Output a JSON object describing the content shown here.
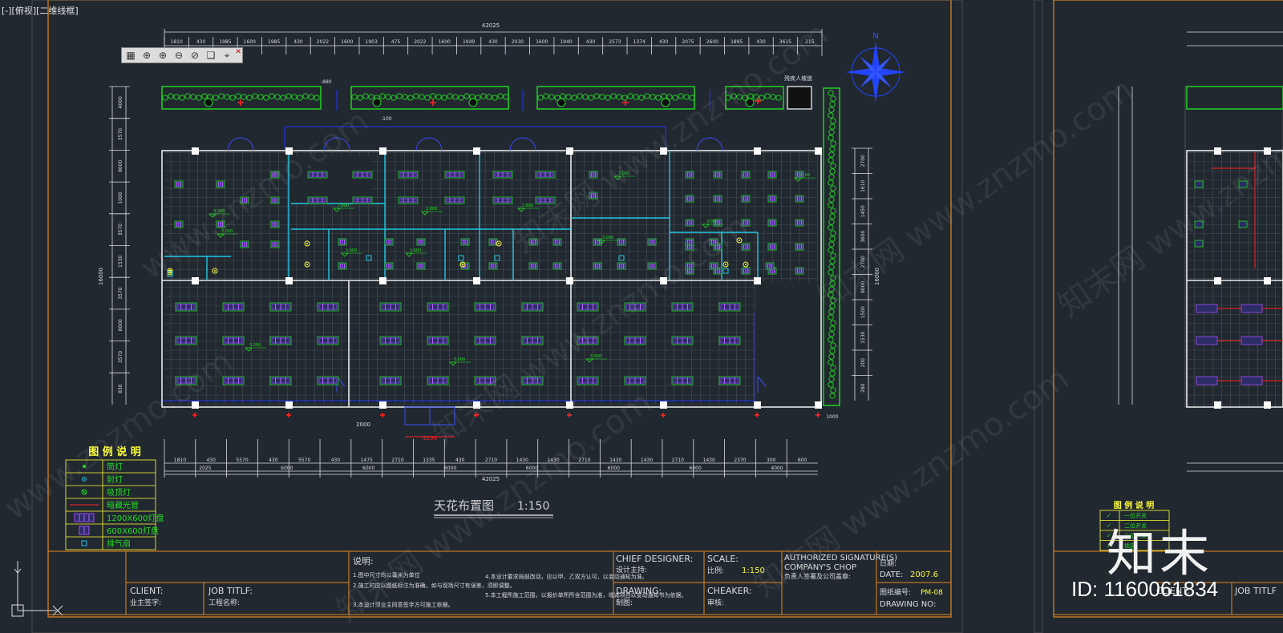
{
  "viewport_label": "[-][俯视][二维线框]",
  "toolbar": {
    "buttons": [
      "view-box-icon",
      "orbit-icon",
      "orbit-plus-icon",
      "orbit-minus-icon",
      "zoom-icon",
      "cube-icon",
      "crosshair-icon"
    ]
  },
  "top_dims": {
    "overall": "42025",
    "segments": [
      "1810",
      "430",
      "1985",
      "1600",
      "1985",
      "430",
      "2022",
      "1600",
      "1903",
      "475",
      "2022",
      "1600",
      "1949",
      "430",
      "2030",
      "1600",
      "1940",
      "430",
      "2573",
      "1374",
      "430",
      "2075",
      "2600",
      "1895",
      "430",
      "3615",
      "215"
    ]
  },
  "bottom_dims": {
    "overall": "42025",
    "row1": [
      "1810",
      "430",
      "5570",
      "430",
      "5570",
      "430",
      "1475",
      "2710",
      "1335",
      "430",
      "2710",
      "1430",
      "1430",
      "2710",
      "1430",
      "1430",
      "2710",
      "1430",
      "2370",
      "300",
      "600"
    ],
    "row2": [
      "2025",
      "6000",
      "6000",
      "6000",
      "6000",
      "6000",
      "6000",
      "4000"
    ]
  },
  "left_dims": {
    "overall": "16000",
    "parts": [
      "4000",
      "3570",
      "8000",
      "1000",
      "3570",
      "1530",
      "3570",
      "8000",
      "3570",
      "830"
    ]
  },
  "right_dims": {
    "overall": "16000",
    "parts": [
      "2700",
      "1610",
      "1450",
      "3600",
      "2700",
      "8000",
      "1500",
      "1530",
      "200",
      "280"
    ]
  },
  "annotations": {
    "ramp": "残疾人坡道",
    "level_top": "-880",
    "level_mid": "-100",
    "dim_door_left": "2000",
    "dim_door": "3290",
    "dim_right_bottom": "1000",
    "ceiling_tag": "3.000",
    "ceiling_tag2": "2.800",
    "ceiling_tag3": "3.100"
  },
  "compass": {
    "label": "N"
  },
  "drawing_title": "天花布置图",
  "drawing_scale": "1:150",
  "legend": {
    "title": "图 例 说 明",
    "items": [
      {
        "symbol": "downlight-icon",
        "label": "筒灯"
      },
      {
        "symbol": "spotlight-icon",
        "label": "射灯"
      },
      {
        "symbol": "ceiling-lamp-icon",
        "label": "吸顶灯"
      },
      {
        "symbol": "light-strip-icon",
        "label": "暗藏光管"
      },
      {
        "symbol": "grille-1200-icon",
        "label": "1200X600灯盘"
      },
      {
        "symbol": "grille-600-icon",
        "label": "600X600灯盘"
      },
      {
        "symbol": "fan-icon",
        "label": "排气扇"
      }
    ]
  },
  "title_block": {
    "client_label": "CLIENT:",
    "client_label_cn": "业主签字:",
    "job_label": "JOB TITLF:",
    "job_label_cn": "工程名称:",
    "notes_title": "说明:",
    "notes": [
      "1.图中尺寸均以毫米为单位",
      "2.施工时应以图纸标注为准确，如与现场尺寸有误差，须即调整。",
      "3.本设计须业主同意签字方可施工依据。",
      "4.本设计要求局部改动，应以甲、乙双方认可，以变动通知为准。",
      "5.本工程所施工范围，以报价单所所含范围为准，增减项目以变动通知书为依据。"
    ],
    "chief_designer": "CHIEF DESIGNER:",
    "chief_designer_cn": "设计主持:",
    "drawing": "DRAWING:",
    "drawing_cn": "制图:",
    "scale_label": "SCALE:",
    "scale_label_cn": "比例:",
    "scale_value": "1:150",
    "checker": "CHEAKER:",
    "checker_cn": "审核:",
    "authorized": "AUTHORIZED SIGNATURE(S)",
    "company_chop": "COMPANY'S CHOP",
    "company_chop_cn": "负责人签署及公司盖章:",
    "date_cn": "日期:",
    "date_label": "DATE:",
    "date_value": "2007.6",
    "drawing_no_cn": "图纸编号:",
    "drawing_no_value": "PM-08",
    "drawing_no_label": "DRAWING NO:"
  },
  "right_sheet": {
    "legend_title": "图 例 说 明",
    "legend_items": [
      "一位开关",
      "二位开关",
      "三位开关",
      "插座"
    ],
    "client_label": "CLIENT:",
    "job_label": "JOB TITLF"
  },
  "watermark": [
    "www.znzmo.com",
    "知末网 www.znzmo.com"
  ],
  "branding": {
    "logo": "知末",
    "id_text": "ID: 1160061834"
  },
  "colors": {
    "background": "#212830",
    "frame": "#e68a1e",
    "wall": "#e8e8e8",
    "planter": "#22dd22",
    "fixture": "#a64dff",
    "door": "#2233ff",
    "cyan": "#22c8e6",
    "dim": "#e8e8e8",
    "text_yellow": "#ffff33"
  }
}
